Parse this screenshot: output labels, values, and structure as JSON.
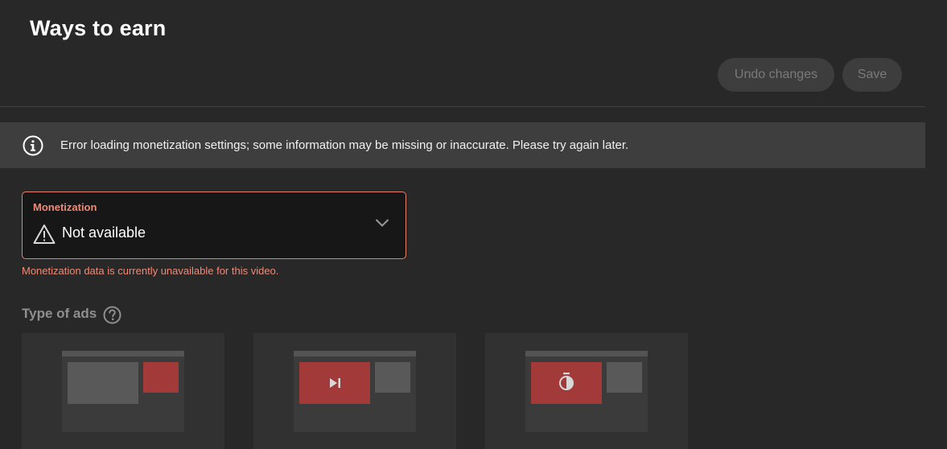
{
  "header": {
    "title": "Ways to earn",
    "undo_label": "Undo changes",
    "save_label": "Save"
  },
  "banner": {
    "icon": "info-icon",
    "message": "Error loading monetization settings; some information may be missing or inaccurate. Please try again later."
  },
  "monetization": {
    "label": "Monetization",
    "icon": "warning-icon",
    "value": "Not available",
    "error": "Monetization data is currently unavailable for this video."
  },
  "ads": {
    "title": "Type of ads",
    "help_icon": "help-icon",
    "cards": [
      {
        "icon": "display-ad-icon"
      },
      {
        "icon": "skippable-ad-icon"
      },
      {
        "icon": "non-skippable-ad-icon"
      }
    ]
  },
  "colors": {
    "background": "#282828",
    "banner": "#3e3e3e",
    "error": "#ef8a77",
    "ad_accent": "#a33a3a"
  }
}
